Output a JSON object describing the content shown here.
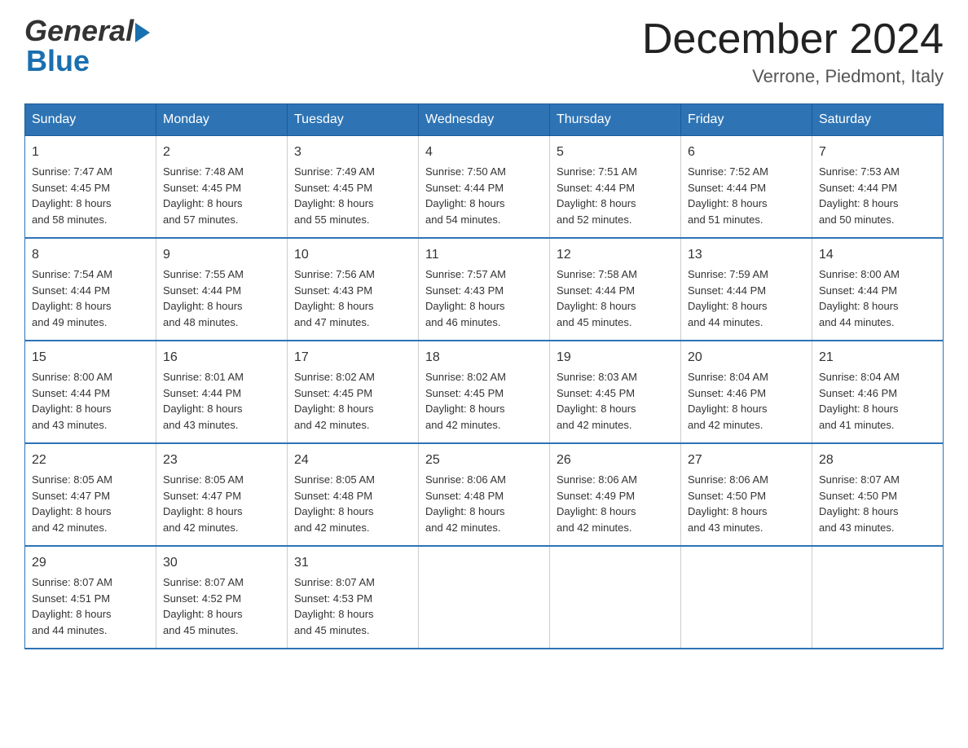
{
  "logo": {
    "part1": "General",
    "arrow": "▶",
    "part2": "Blue"
  },
  "header": {
    "month": "December 2024",
    "location": "Verrone, Piedmont, Italy"
  },
  "days": [
    "Sunday",
    "Monday",
    "Tuesday",
    "Wednesday",
    "Thursday",
    "Friday",
    "Saturday"
  ],
  "weeks": [
    [
      {
        "num": "1",
        "sunrise": "7:47 AM",
        "sunset": "4:45 PM",
        "daylight": "8 hours and 58 minutes."
      },
      {
        "num": "2",
        "sunrise": "7:48 AM",
        "sunset": "4:45 PM",
        "daylight": "8 hours and 57 minutes."
      },
      {
        "num": "3",
        "sunrise": "7:49 AM",
        "sunset": "4:45 PM",
        "daylight": "8 hours and 55 minutes."
      },
      {
        "num": "4",
        "sunrise": "7:50 AM",
        "sunset": "4:44 PM",
        "daylight": "8 hours and 54 minutes."
      },
      {
        "num": "5",
        "sunrise": "7:51 AM",
        "sunset": "4:44 PM",
        "daylight": "8 hours and 52 minutes."
      },
      {
        "num": "6",
        "sunrise": "7:52 AM",
        "sunset": "4:44 PM",
        "daylight": "8 hours and 51 minutes."
      },
      {
        "num": "7",
        "sunrise": "7:53 AM",
        "sunset": "4:44 PM",
        "daylight": "8 hours and 50 minutes."
      }
    ],
    [
      {
        "num": "8",
        "sunrise": "7:54 AM",
        "sunset": "4:44 PM",
        "daylight": "8 hours and 49 minutes."
      },
      {
        "num": "9",
        "sunrise": "7:55 AM",
        "sunset": "4:44 PM",
        "daylight": "8 hours and 48 minutes."
      },
      {
        "num": "10",
        "sunrise": "7:56 AM",
        "sunset": "4:43 PM",
        "daylight": "8 hours and 47 minutes."
      },
      {
        "num": "11",
        "sunrise": "7:57 AM",
        "sunset": "4:43 PM",
        "daylight": "8 hours and 46 minutes."
      },
      {
        "num": "12",
        "sunrise": "7:58 AM",
        "sunset": "4:44 PM",
        "daylight": "8 hours and 45 minutes."
      },
      {
        "num": "13",
        "sunrise": "7:59 AM",
        "sunset": "4:44 PM",
        "daylight": "8 hours and 44 minutes."
      },
      {
        "num": "14",
        "sunrise": "8:00 AM",
        "sunset": "4:44 PM",
        "daylight": "8 hours and 44 minutes."
      }
    ],
    [
      {
        "num": "15",
        "sunrise": "8:00 AM",
        "sunset": "4:44 PM",
        "daylight": "8 hours and 43 minutes."
      },
      {
        "num": "16",
        "sunrise": "8:01 AM",
        "sunset": "4:44 PM",
        "daylight": "8 hours and 43 minutes."
      },
      {
        "num": "17",
        "sunrise": "8:02 AM",
        "sunset": "4:45 PM",
        "daylight": "8 hours and 42 minutes."
      },
      {
        "num": "18",
        "sunrise": "8:02 AM",
        "sunset": "4:45 PM",
        "daylight": "8 hours and 42 minutes."
      },
      {
        "num": "19",
        "sunrise": "8:03 AM",
        "sunset": "4:45 PM",
        "daylight": "8 hours and 42 minutes."
      },
      {
        "num": "20",
        "sunrise": "8:04 AM",
        "sunset": "4:46 PM",
        "daylight": "8 hours and 42 minutes."
      },
      {
        "num": "21",
        "sunrise": "8:04 AM",
        "sunset": "4:46 PM",
        "daylight": "8 hours and 41 minutes."
      }
    ],
    [
      {
        "num": "22",
        "sunrise": "8:05 AM",
        "sunset": "4:47 PM",
        "daylight": "8 hours and 42 minutes."
      },
      {
        "num": "23",
        "sunrise": "8:05 AM",
        "sunset": "4:47 PM",
        "daylight": "8 hours and 42 minutes."
      },
      {
        "num": "24",
        "sunrise": "8:05 AM",
        "sunset": "4:48 PM",
        "daylight": "8 hours and 42 minutes."
      },
      {
        "num": "25",
        "sunrise": "8:06 AM",
        "sunset": "4:48 PM",
        "daylight": "8 hours and 42 minutes."
      },
      {
        "num": "26",
        "sunrise": "8:06 AM",
        "sunset": "4:49 PM",
        "daylight": "8 hours and 42 minutes."
      },
      {
        "num": "27",
        "sunrise": "8:06 AM",
        "sunset": "4:50 PM",
        "daylight": "8 hours and 43 minutes."
      },
      {
        "num": "28",
        "sunrise": "8:07 AM",
        "sunset": "4:50 PM",
        "daylight": "8 hours and 43 minutes."
      }
    ],
    [
      {
        "num": "29",
        "sunrise": "8:07 AM",
        "sunset": "4:51 PM",
        "daylight": "8 hours and 44 minutes."
      },
      {
        "num": "30",
        "sunrise": "8:07 AM",
        "sunset": "4:52 PM",
        "daylight": "8 hours and 45 minutes."
      },
      {
        "num": "31",
        "sunrise": "8:07 AM",
        "sunset": "4:53 PM",
        "daylight": "8 hours and 45 minutes."
      },
      null,
      null,
      null,
      null
    ]
  ],
  "labels": {
    "sunrise": "Sunrise: ",
    "sunset": "Sunset: ",
    "daylight": "Daylight: "
  }
}
